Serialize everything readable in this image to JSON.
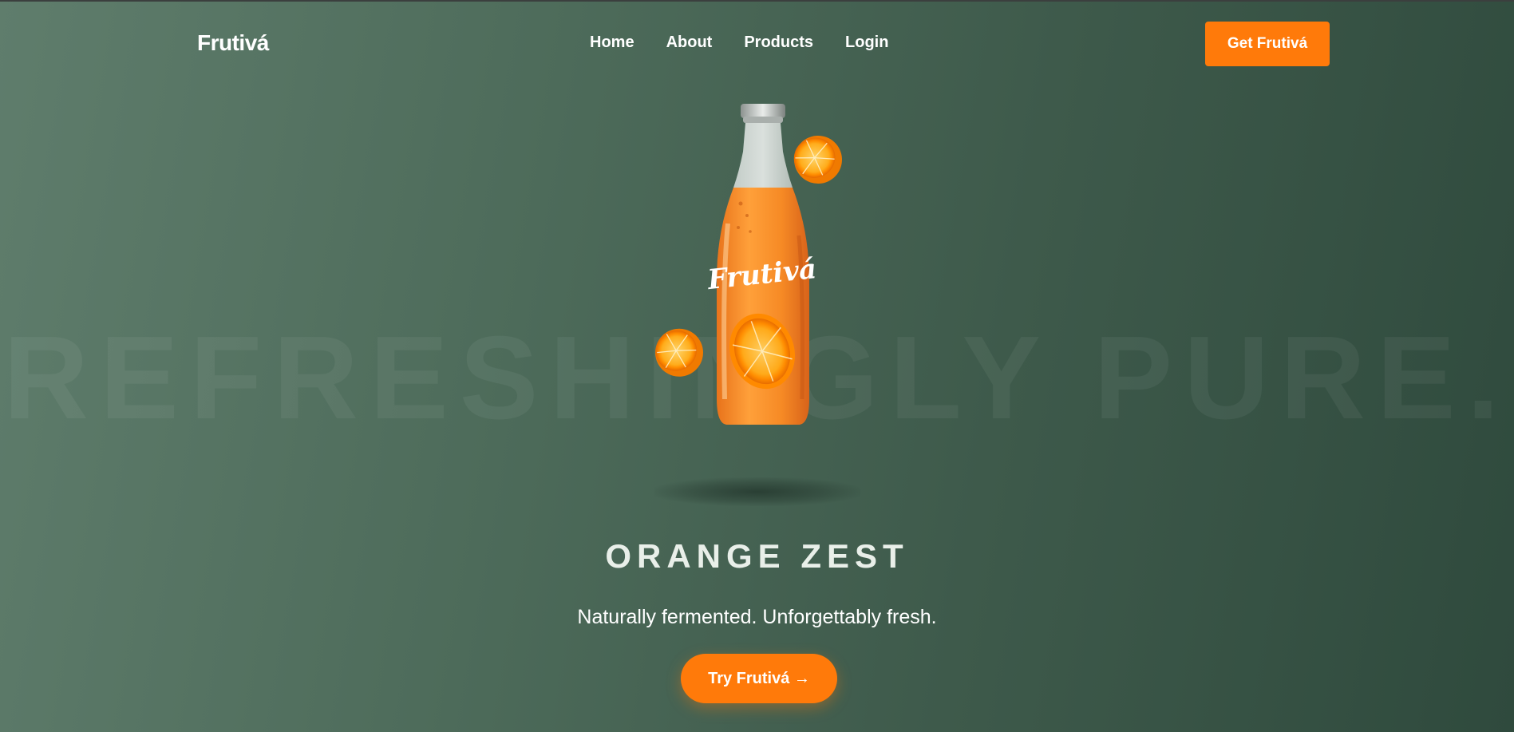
{
  "brand": {
    "logo_text": "Frutivá",
    "accent_color": "#ff7a0a"
  },
  "nav": {
    "links": [
      {
        "label": "Home"
      },
      {
        "label": "About"
      },
      {
        "label": "Products"
      },
      {
        "label": "Login"
      }
    ],
    "cta_label": "Get Frutivá"
  },
  "hero": {
    "background_headline": "REFRESHINGLY PURE.",
    "bottle_label_text": "Frutivá",
    "flavor_name": "ORANGE ZEST",
    "tagline": "Naturally fermented. Unforgettably fresh.",
    "cta_label": "Try Frutivá →"
  }
}
